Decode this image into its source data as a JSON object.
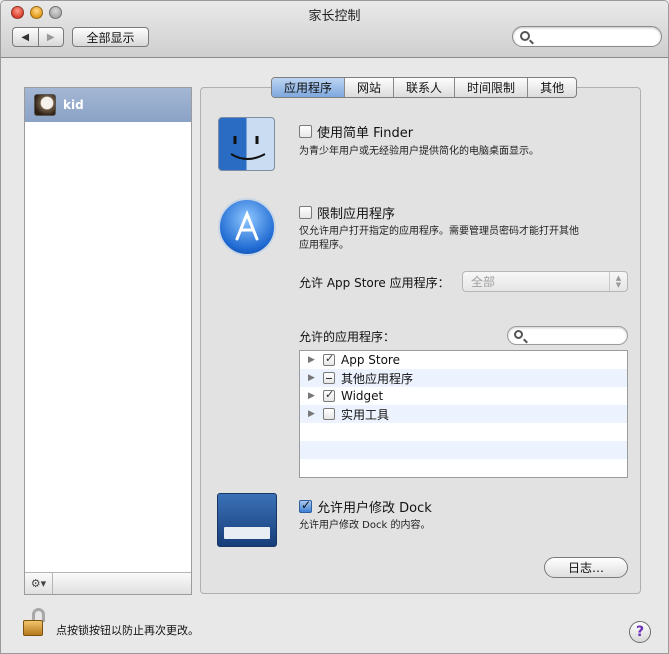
{
  "window": {
    "title": "家长控制"
  },
  "toolbar": {
    "back_icon": "◀",
    "forward_icon": "▶",
    "show_all_label": "全部显示",
    "search_placeholder": ""
  },
  "sidebar": {
    "users": [
      {
        "name": "kid",
        "selected": true
      }
    ],
    "footer_action": "⚙▾"
  },
  "tabs": [
    {
      "label": "应用程序",
      "active": true
    },
    {
      "label": "网站",
      "active": false
    },
    {
      "label": "联系人",
      "active": false
    },
    {
      "label": "时间限制",
      "active": false
    },
    {
      "label": "其他",
      "active": false
    }
  ],
  "options": {
    "simple_finder": {
      "label": "使用简单 Finder",
      "checked": false,
      "description": "为青少年用户或无经验用户提供简化的电脑桌面显示。"
    },
    "limit_apps": {
      "label": "限制应用程序",
      "checked": false,
      "description_line1": "仅允许用户打开指定的应用程序。需要管理员密码才能打开其他",
      "description_line2": "应用程序。"
    },
    "app_store": {
      "label": "允许 App Store 应用程序：",
      "value": "全部"
    },
    "allowed_apps": {
      "label": "允许的应用程序：",
      "search_placeholder": "",
      "items": [
        {
          "name": "App Store",
          "state": "checked"
        },
        {
          "name": "其他应用程序",
          "state": "mixed"
        },
        {
          "name": "Widget",
          "state": "checked"
        },
        {
          "name": "实用工具",
          "state": "unchecked"
        }
      ]
    },
    "modify_dock": {
      "label": "允许用户修改 Dock",
      "checked": true,
      "description": "允许用户修改 Dock 的内容。"
    }
  },
  "buttons": {
    "log_label": "日志…",
    "help_label": "?"
  },
  "footer": {
    "lock_text": "点按锁按钮以防止再次更改。"
  }
}
